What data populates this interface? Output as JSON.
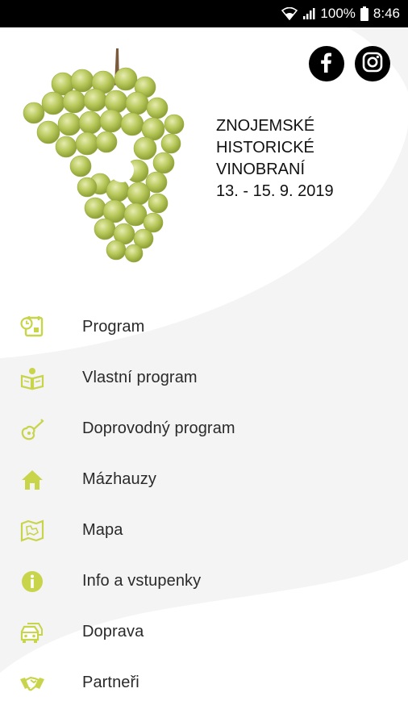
{
  "status_bar": {
    "battery": "100%",
    "time": "8:46",
    "icons": [
      "wifi-icon",
      "signal-icon",
      "battery-icon"
    ]
  },
  "header": {
    "title_lines": [
      "ZNOJEMSKÉ",
      "HISTORICKÉ",
      "VINOBRANÍ",
      "13. - 15. 9. 2019"
    ],
    "social": [
      "facebook-icon",
      "instagram-icon"
    ]
  },
  "menu": {
    "accent_color": "#c8d44a",
    "items": [
      {
        "label": "Program",
        "icon": "calendar-clock-icon"
      },
      {
        "label": "Vlastní program",
        "icon": "open-book-icon"
      },
      {
        "label": "Doprovodný program",
        "icon": "guitar-icon"
      },
      {
        "label": "Mázhauzy",
        "icon": "home-icon"
      },
      {
        "label": "Mapa",
        "icon": "map-icon"
      },
      {
        "label": "Info a vstupenky",
        "icon": "info-icon"
      },
      {
        "label": "Doprava",
        "icon": "cars-icon"
      },
      {
        "label": "Partneři",
        "icon": "handshake-icon"
      }
    ]
  }
}
